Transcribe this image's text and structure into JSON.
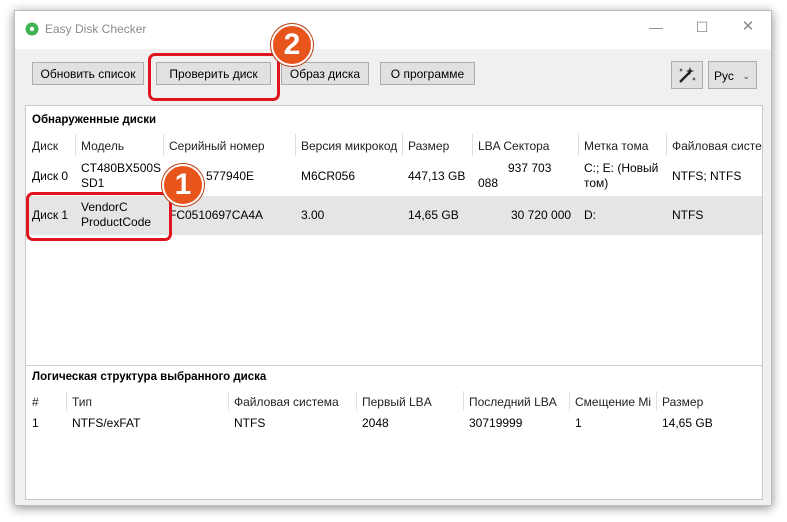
{
  "window": {
    "title": "Easy Disk Checker",
    "controls": {
      "minimize": "—",
      "maximize": "☐",
      "close": "✕"
    }
  },
  "toolbar": {
    "refresh_label": "Обновить список",
    "check_label": "Проверить диск",
    "image_label": "Образ диска",
    "about_label": "О программе",
    "lang_label": "Рус"
  },
  "callouts": {
    "one": "1",
    "two": "2"
  },
  "disks": {
    "section_title": "Обнаруженные диски",
    "columns": [
      "Диск",
      "Модель",
      "Серийный номер",
      "Версия микрокод",
      "Размер",
      "LBA Сектора",
      "Метка тома",
      "Файловая систе"
    ],
    "rows": [
      {
        "disk": "Диск 0",
        "model": [
          "CT480BX500S",
          "SD1"
        ],
        "serial": "577940E",
        "firmware": "M6CR056",
        "size": "447,13 GB",
        "lba": [
          "937 703",
          "088"
        ],
        "label": [
          "C:; E: (Новый",
          "том)"
        ],
        "fs": "NTFS; NTFS"
      },
      {
        "disk": "Диск 1",
        "model": [
          "VendorC",
          "ProductCode"
        ],
        "serial": "FC0510697CA4A",
        "firmware": "3.00",
        "size": "14,65 GB",
        "lba": [
          "30 720 000"
        ],
        "label": [
          "D:"
        ],
        "fs": "NTFS"
      }
    ]
  },
  "logical": {
    "section_title": "Логическая структура выбранного диска",
    "columns": [
      "#",
      "Тип",
      "Файловая система",
      "Первый LBA",
      "Последний LBA",
      "Смещение Mi",
      "Размер"
    ],
    "rows": [
      {
        "num": "1",
        "type": "NTFS/exFAT",
        "fs": "NTFS",
        "first": "2048",
        "last": "30719999",
        "offset": "1",
        "size": "14,65 GB"
      }
    ]
  },
  "colors": {
    "accent_highlight": "#e0141e",
    "badge": "#e8551c",
    "selected_row": "#e5e5e5"
  }
}
